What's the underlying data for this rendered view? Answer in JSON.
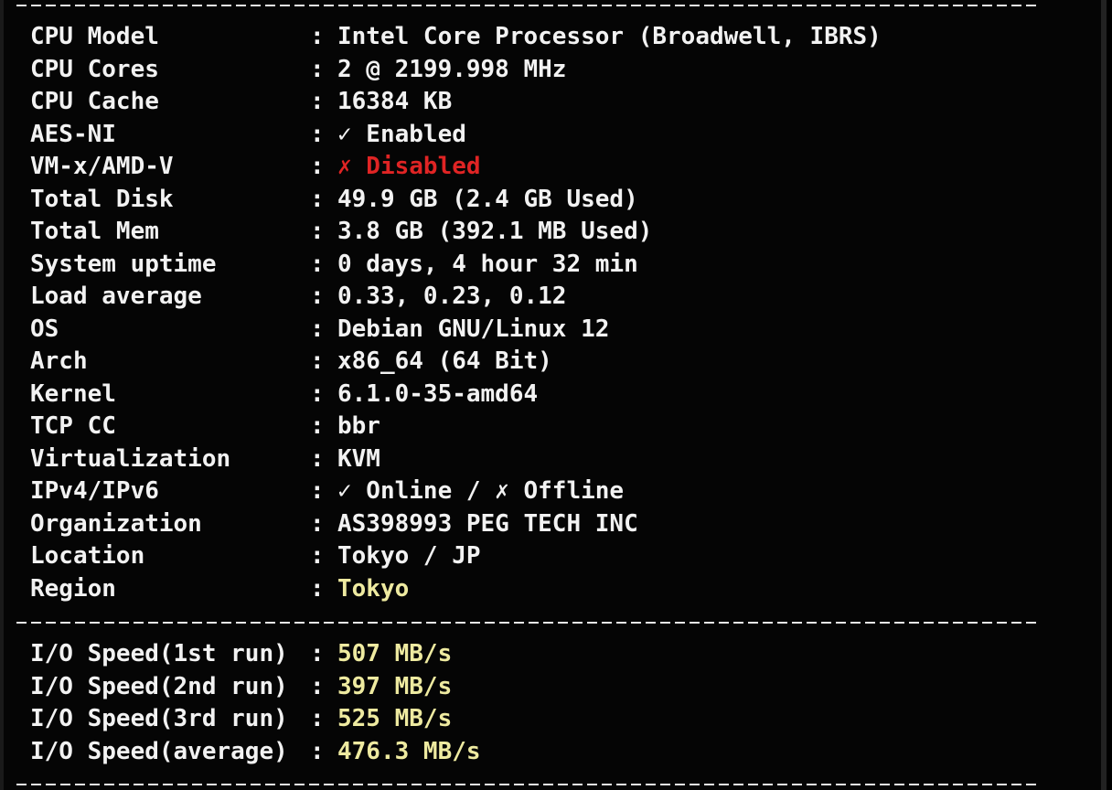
{
  "divider_text": "--------------------------------------------------------------------------------------",
  "system": [
    {
      "label": "CPU Model",
      "value": "Intel Core Processor (Broadwell, IBRS)",
      "color": "#f2f2f2"
    },
    {
      "label": "CPU Cores",
      "value": "2 @ 2199.998 MHz",
      "color": "#f2f2f2"
    },
    {
      "label": "CPU Cache",
      "value": "16384 KB",
      "color": "#f2f2f2"
    },
    {
      "label": "AES-NI",
      "value": "✓ Enabled",
      "color": "#f2f2f2"
    },
    {
      "label": "VM-x/AMD-V",
      "value": "✗ Disabled",
      "color": "#e02424"
    },
    {
      "label": "Total Disk",
      "value": "49.9 GB (2.4 GB Used)",
      "color": "#f2f2f2"
    },
    {
      "label": "Total Mem",
      "value": "3.8 GB (392.1 MB Used)",
      "color": "#f2f2f2"
    },
    {
      "label": "System uptime",
      "value": "0 days, 4 hour 32 min",
      "color": "#f2f2f2"
    },
    {
      "label": "Load average",
      "value": "0.33, 0.23, 0.12",
      "color": "#f2f2f2"
    },
    {
      "label": "OS",
      "value": "Debian GNU/Linux 12",
      "color": "#f2f2f2"
    },
    {
      "label": "Arch",
      "value": "x86_64 (64 Bit)",
      "color": "#f2f2f2"
    },
    {
      "label": "Kernel",
      "value": "6.1.0-35-amd64",
      "color": "#f2f2f2"
    },
    {
      "label": "TCP CC",
      "value": "bbr",
      "color": "#f2f2f2"
    },
    {
      "label": "Virtualization",
      "value": "KVM",
      "color": "#f2f2f2"
    },
    {
      "label": "IPv4/IPv6",
      "value": "✓ Online / ✗ Offline",
      "color": "#f2f2f2"
    },
    {
      "label": "Organization",
      "value": "AS398993 PEG TECH INC",
      "color": "#f2f2f2"
    },
    {
      "label": "Location",
      "value": "Tokyo / JP",
      "color": "#f2f2f2"
    },
    {
      "label": "Region",
      "value": "Tokyo",
      "color": "#eeeaa0"
    }
  ],
  "io": [
    {
      "label": "I/O Speed(1st run)",
      "value": "507 MB/s",
      "color": "#eeeaa0"
    },
    {
      "label": "I/O Speed(2nd run)",
      "value": "397 MB/s",
      "color": "#eeeaa0"
    },
    {
      "label": "I/O Speed(3rd run)",
      "value": "525 MB/s",
      "color": "#eeeaa0"
    },
    {
      "label": "I/O Speed(average)",
      "value": "476.3 MB/s",
      "color": "#eeeaa0"
    }
  ],
  "separator": ":"
}
